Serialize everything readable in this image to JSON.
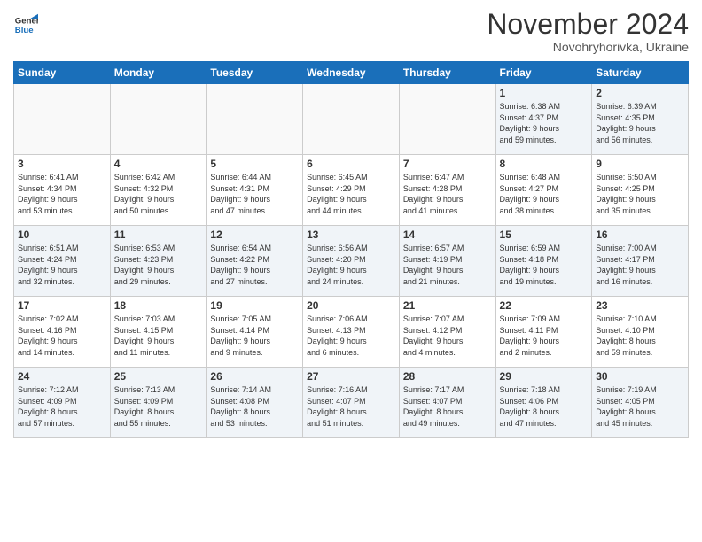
{
  "logo": {
    "line1": "General",
    "line2": "Blue"
  },
  "title": "November 2024",
  "subtitle": "Novohryhorivka, Ukraine",
  "weekdays": [
    "Sunday",
    "Monday",
    "Tuesday",
    "Wednesday",
    "Thursday",
    "Friday",
    "Saturday"
  ],
  "weeks": [
    [
      {
        "day": "",
        "info": ""
      },
      {
        "day": "",
        "info": ""
      },
      {
        "day": "",
        "info": ""
      },
      {
        "day": "",
        "info": ""
      },
      {
        "day": "",
        "info": ""
      },
      {
        "day": "1",
        "info": "Sunrise: 6:38 AM\nSunset: 4:37 PM\nDaylight: 9 hours\nand 59 minutes."
      },
      {
        "day": "2",
        "info": "Sunrise: 6:39 AM\nSunset: 4:35 PM\nDaylight: 9 hours\nand 56 minutes."
      }
    ],
    [
      {
        "day": "3",
        "info": "Sunrise: 6:41 AM\nSunset: 4:34 PM\nDaylight: 9 hours\nand 53 minutes."
      },
      {
        "day": "4",
        "info": "Sunrise: 6:42 AM\nSunset: 4:32 PM\nDaylight: 9 hours\nand 50 minutes."
      },
      {
        "day": "5",
        "info": "Sunrise: 6:44 AM\nSunset: 4:31 PM\nDaylight: 9 hours\nand 47 minutes."
      },
      {
        "day": "6",
        "info": "Sunrise: 6:45 AM\nSunset: 4:29 PM\nDaylight: 9 hours\nand 44 minutes."
      },
      {
        "day": "7",
        "info": "Sunrise: 6:47 AM\nSunset: 4:28 PM\nDaylight: 9 hours\nand 41 minutes."
      },
      {
        "day": "8",
        "info": "Sunrise: 6:48 AM\nSunset: 4:27 PM\nDaylight: 9 hours\nand 38 minutes."
      },
      {
        "day": "9",
        "info": "Sunrise: 6:50 AM\nSunset: 4:25 PM\nDaylight: 9 hours\nand 35 minutes."
      }
    ],
    [
      {
        "day": "10",
        "info": "Sunrise: 6:51 AM\nSunset: 4:24 PM\nDaylight: 9 hours\nand 32 minutes."
      },
      {
        "day": "11",
        "info": "Sunrise: 6:53 AM\nSunset: 4:23 PM\nDaylight: 9 hours\nand 29 minutes."
      },
      {
        "day": "12",
        "info": "Sunrise: 6:54 AM\nSunset: 4:22 PM\nDaylight: 9 hours\nand 27 minutes."
      },
      {
        "day": "13",
        "info": "Sunrise: 6:56 AM\nSunset: 4:20 PM\nDaylight: 9 hours\nand 24 minutes."
      },
      {
        "day": "14",
        "info": "Sunrise: 6:57 AM\nSunset: 4:19 PM\nDaylight: 9 hours\nand 21 minutes."
      },
      {
        "day": "15",
        "info": "Sunrise: 6:59 AM\nSunset: 4:18 PM\nDaylight: 9 hours\nand 19 minutes."
      },
      {
        "day": "16",
        "info": "Sunrise: 7:00 AM\nSunset: 4:17 PM\nDaylight: 9 hours\nand 16 minutes."
      }
    ],
    [
      {
        "day": "17",
        "info": "Sunrise: 7:02 AM\nSunset: 4:16 PM\nDaylight: 9 hours\nand 14 minutes."
      },
      {
        "day": "18",
        "info": "Sunrise: 7:03 AM\nSunset: 4:15 PM\nDaylight: 9 hours\nand 11 minutes."
      },
      {
        "day": "19",
        "info": "Sunrise: 7:05 AM\nSunset: 4:14 PM\nDaylight: 9 hours\nand 9 minutes."
      },
      {
        "day": "20",
        "info": "Sunrise: 7:06 AM\nSunset: 4:13 PM\nDaylight: 9 hours\nand 6 minutes."
      },
      {
        "day": "21",
        "info": "Sunrise: 7:07 AM\nSunset: 4:12 PM\nDaylight: 9 hours\nand 4 minutes."
      },
      {
        "day": "22",
        "info": "Sunrise: 7:09 AM\nSunset: 4:11 PM\nDaylight: 9 hours\nand 2 minutes."
      },
      {
        "day": "23",
        "info": "Sunrise: 7:10 AM\nSunset: 4:10 PM\nDaylight: 8 hours\nand 59 minutes."
      }
    ],
    [
      {
        "day": "24",
        "info": "Sunrise: 7:12 AM\nSunset: 4:09 PM\nDaylight: 8 hours\nand 57 minutes."
      },
      {
        "day": "25",
        "info": "Sunrise: 7:13 AM\nSunset: 4:09 PM\nDaylight: 8 hours\nand 55 minutes."
      },
      {
        "day": "26",
        "info": "Sunrise: 7:14 AM\nSunset: 4:08 PM\nDaylight: 8 hours\nand 53 minutes."
      },
      {
        "day": "27",
        "info": "Sunrise: 7:16 AM\nSunset: 4:07 PM\nDaylight: 8 hours\nand 51 minutes."
      },
      {
        "day": "28",
        "info": "Sunrise: 7:17 AM\nSunset: 4:07 PM\nDaylight: 8 hours\nand 49 minutes."
      },
      {
        "day": "29",
        "info": "Sunrise: 7:18 AM\nSunset: 4:06 PM\nDaylight: 8 hours\nand 47 minutes."
      },
      {
        "day": "30",
        "info": "Sunrise: 7:19 AM\nSunset: 4:05 PM\nDaylight: 8 hours\nand 45 minutes."
      }
    ]
  ]
}
